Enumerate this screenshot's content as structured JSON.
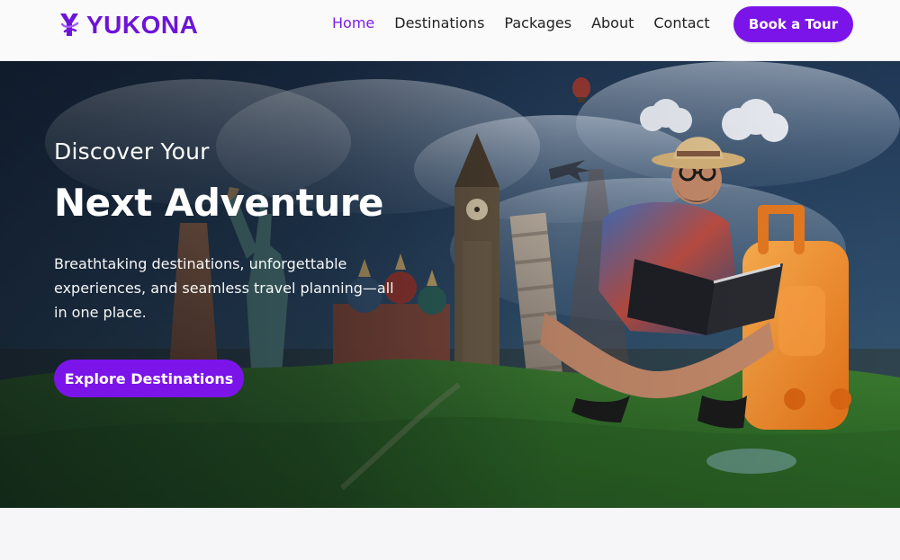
{
  "brand": {
    "name": "YUKONA",
    "logo_icon": "yukona-logo-icon",
    "accent_color": "#7b14e9"
  },
  "nav": {
    "items": [
      {
        "label": "Home",
        "active": true
      },
      {
        "label": "Destinations",
        "active": false
      },
      {
        "label": "Packages",
        "active": false
      },
      {
        "label": "About",
        "active": false
      },
      {
        "label": "Contact",
        "active": false
      }
    ]
  },
  "header": {
    "cta_label": "Book a Tour"
  },
  "hero": {
    "subtitle": "Discover Your",
    "title": "Next Adventure",
    "description": "Breathtaking destinations, unforgettable experiences, and seamless travel planning—all in one place.",
    "button_label": "Explore Destinations"
  }
}
